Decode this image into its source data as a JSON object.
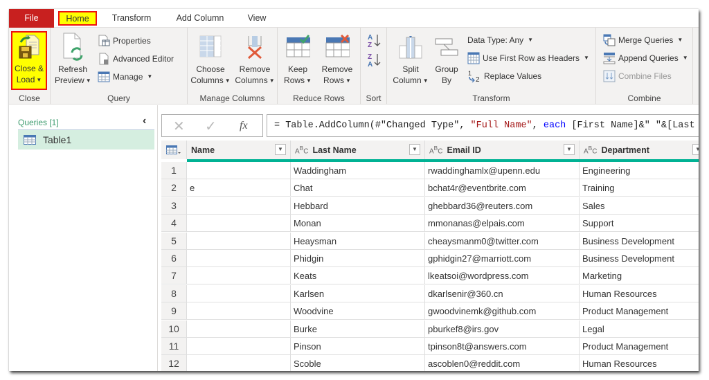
{
  "tabs": {
    "file": "File",
    "home": "Home",
    "transform": "Transform",
    "add_column": "Add Column",
    "view": "View"
  },
  "ribbon": {
    "close": {
      "group_label": "Close",
      "close_load_line1": "Close &",
      "close_load_line2": "Load"
    },
    "query": {
      "group_label": "Query",
      "refresh_line1": "Refresh",
      "refresh_line2": "Preview",
      "properties": "Properties",
      "advanced_editor": "Advanced Editor",
      "manage": "Manage"
    },
    "manage_columns": {
      "group_label": "Manage Columns",
      "choose_line1": "Choose",
      "choose_line2": "Columns",
      "remove_line1": "Remove",
      "remove_line2": "Columns"
    },
    "reduce_rows": {
      "group_label": "Reduce Rows",
      "keep_line1": "Keep",
      "keep_line2": "Rows",
      "remove_line1": "Remove",
      "remove_line2": "Rows"
    },
    "sort": {
      "group_label": "Sort"
    },
    "transform": {
      "group_label": "Transform",
      "split_line1": "Split",
      "split_line2": "Column",
      "group_line1": "Group",
      "group_line2": "By",
      "data_type": "Data Type: Any",
      "use_first_row": "Use First Row as Headers",
      "replace_values": "Replace Values"
    },
    "combine": {
      "group_label": "Combine",
      "merge_queries": "Merge Queries",
      "append_queries": "Append Queries",
      "combine_files": "Combine Files"
    }
  },
  "queries_pane": {
    "title": "Queries [1]",
    "items": [
      {
        "label": "Table1"
      }
    ]
  },
  "formula_bar": {
    "prefix": "= Table.AddColumn(#\"Changed Type\", ",
    "string1": "\"Full Name\"",
    "sep": ", ",
    "keyword": "each",
    "rest": " [First Name]&\" \"&[Last Nam"
  },
  "grid": {
    "columns": [
      {
        "label": "Name",
        "type_icon": ""
      },
      {
        "label": "Last Name",
        "type_icon": "ABC"
      },
      {
        "label": "Email ID",
        "type_icon": "ABC"
      },
      {
        "label": "Department",
        "type_icon": "ABC"
      }
    ],
    "rows": [
      {
        "n": "1",
        "name": "",
        "last": "Waddingham",
        "email": "rwaddinghamlx@upenn.edu",
        "dept": "Engineering"
      },
      {
        "n": "2",
        "name": "e",
        "last": "Chat",
        "email": "bchat4r@eventbrite.com",
        "dept": "Training"
      },
      {
        "n": "3",
        "name": "",
        "last": "Hebbard",
        "email": "ghebbard36@reuters.com",
        "dept": "Sales"
      },
      {
        "n": "4",
        "name": "",
        "last": "Monan",
        "email": "mmonanas@elpais.com",
        "dept": "Support"
      },
      {
        "n": "5",
        "name": "",
        "last": "Heaysman",
        "email": "cheaysmanm0@twitter.com",
        "dept": "Business Development"
      },
      {
        "n": "6",
        "name": "",
        "last": "Phidgin",
        "email": "gphidgin27@marriott.com",
        "dept": "Business Development"
      },
      {
        "n": "7",
        "name": "",
        "last": "Keats",
        "email": "lkeatsoi@wordpress.com",
        "dept": "Marketing"
      },
      {
        "n": "8",
        "name": "",
        "last": "Karlsen",
        "email": "dkarlsenir@360.cn",
        "dept": "Human Resources"
      },
      {
        "n": "9",
        "name": "",
        "last": "Woodvine",
        "email": "gwoodvinemk@github.com",
        "dept": "Product Management"
      },
      {
        "n": "10",
        "name": "",
        "last": "Burke",
        "email": "pburkef8@irs.gov",
        "dept": "Legal"
      },
      {
        "n": "11",
        "name": "",
        "last": "Pinson",
        "email": "tpinson8t@answers.com",
        "dept": "Product Management"
      },
      {
        "n": "12",
        "name": "",
        "last": "Scoble",
        "email": "ascoblen0@reddit.com",
        "dept": "Human Resources"
      }
    ]
  },
  "colors": {
    "file_tab": "#c8201f",
    "highlight": "#ffff00",
    "highlight_border": "#ee1111",
    "quality_bar": "#00b294",
    "query_selected": "#d5eee0"
  }
}
